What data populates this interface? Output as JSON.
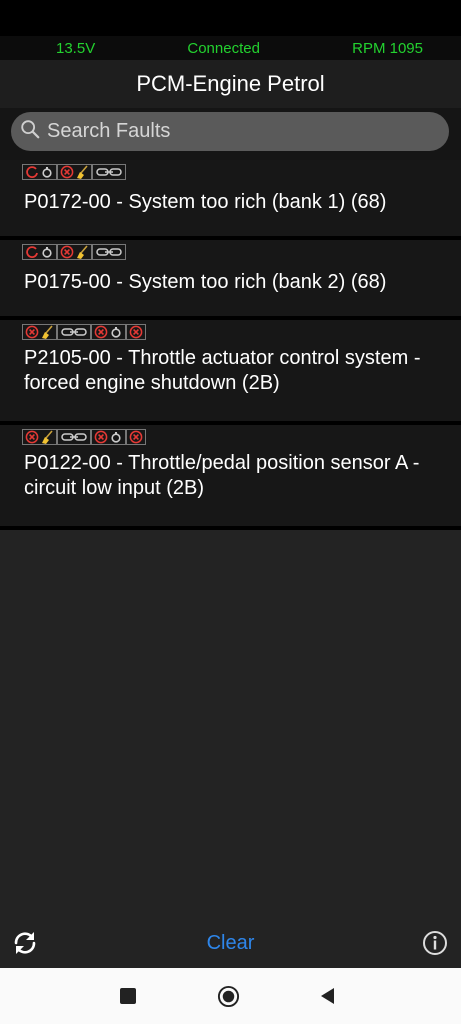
{
  "status": {
    "voltage": "13.5V",
    "connection": "Connected",
    "rpm": "RPM 1095"
  },
  "header": {
    "title": "PCM-Engine Petrol"
  },
  "search": {
    "placeholder": "Search Faults"
  },
  "faults": [
    {
      "text": "P0172-00 - System too rich (bank 1) (68)",
      "icons": [
        [
          "refresh",
          "circle"
        ],
        [
          "x",
          "broom"
        ],
        [
          "link"
        ]
      ]
    },
    {
      "text": "P0175-00 - System too rich (bank 2) (68)",
      "icons": [
        [
          "refresh",
          "circle"
        ],
        [
          "x",
          "broom"
        ],
        [
          "link"
        ]
      ]
    },
    {
      "text": "P2105-00 - Throttle actuator control system - forced engine shutdown (2B)",
      "icons": [
        [
          "x",
          "broom"
        ],
        [
          "link"
        ],
        [
          "x",
          "circle"
        ],
        [
          "x"
        ]
      ]
    },
    {
      "text": "P0122-00 - Throttle/pedal position sensor A - circuit low input (2B)",
      "icons": [
        [
          "x",
          "broom"
        ],
        [
          "link"
        ],
        [
          "x",
          "circle"
        ],
        [
          "x"
        ]
      ]
    }
  ],
  "footer": {
    "clear_label": "Clear",
    "refresh_icon": "refresh-icon",
    "info_icon": "info-icon"
  },
  "nav": {
    "recents_icon": "square-icon",
    "home_icon": "home-icon",
    "back_icon": "back-icon"
  },
  "colors": {
    "status_green": "#23d12f",
    "accent_blue": "#2e86ea",
    "icon_red": "#e53935"
  }
}
